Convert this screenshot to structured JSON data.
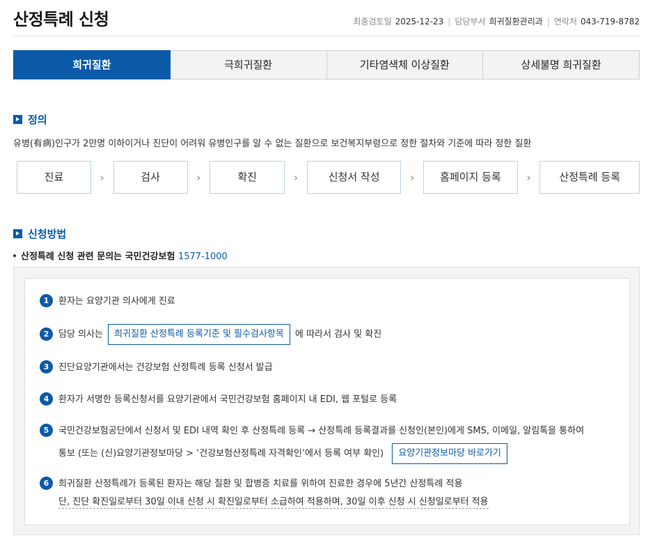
{
  "header": {
    "title": "산정특례 신청",
    "review_label": "최종검토일",
    "review_date": "2025-12-23",
    "dept_label": "담당부서",
    "dept": "희귀질환관리과",
    "contact_label": "연락처",
    "contact": "043-719-8782"
  },
  "tabs": [
    {
      "label": "희귀질환",
      "active": true
    },
    {
      "label": "극희귀질환",
      "active": false
    },
    {
      "label": "기타염색체 이상질환",
      "active": false
    },
    {
      "label": "상세불명 희귀질환",
      "active": false
    }
  ],
  "definition": {
    "title": "정의",
    "text": "유병(有病)인구가 2만명 이하이거나 진단이 어려워 유병인구를 알 수 없는 질환으로 보건복지부령으로 정한 절차와 기준에 따라 정한 질환"
  },
  "steps": [
    "진료",
    "검사",
    "확진",
    "신청서 작성",
    "홈페이지 등록",
    "산정특례 등록"
  ],
  "application": {
    "title": "신청방법",
    "note_text": "산정특례 신청 관련 문의는 국민건강보험",
    "note_phone": "1577-1000",
    "items": [
      {
        "num": "1",
        "text": "환자는 요양기관 의사에게 진료"
      },
      {
        "num": "2",
        "text_before": "담당 의사는",
        "link": "희귀질환 산정특례 등록기준 및 필수검사항목",
        "text_after": "에 따라서 검사 및 확진"
      },
      {
        "num": "3",
        "text": "진단요양기관에서는 건강보험 산정특례 등록 신청서 발급"
      },
      {
        "num": "4",
        "text": "환자가 서명한 등록신청서를 요양기관에서 국민건강보험 홈페이지 내 EDI, 웹 포털로 등록"
      },
      {
        "num": "5",
        "line1": "국민건강보험공단에서 신청서 및 EDI 내역 확인 후 산정특례 등록 → 산정특례 등록결과를 신청인(본인)에게 SMS, 이메일, 알림톡을 통하여",
        "line2": "통보 (또는 (신)요양기관정보마당 > ‘건강보험산정특례 자격확인’에서 등록 여부 확인)",
        "link": "요양기관정보마당 바로가기"
      },
      {
        "num": "6",
        "line1": "희귀질환 산정특례가 등록된 환자는 해당 질환 및 합병증 치료를 위하여 진료한 경우에 5년간 산정특례 적용",
        "line2": "단, 진단 확진일로부터 30일 이내 신청 시 확진일로부터 소급하여 적용하며, 30일 이후 신청 시 신청일로부터 적용"
      }
    ]
  }
}
